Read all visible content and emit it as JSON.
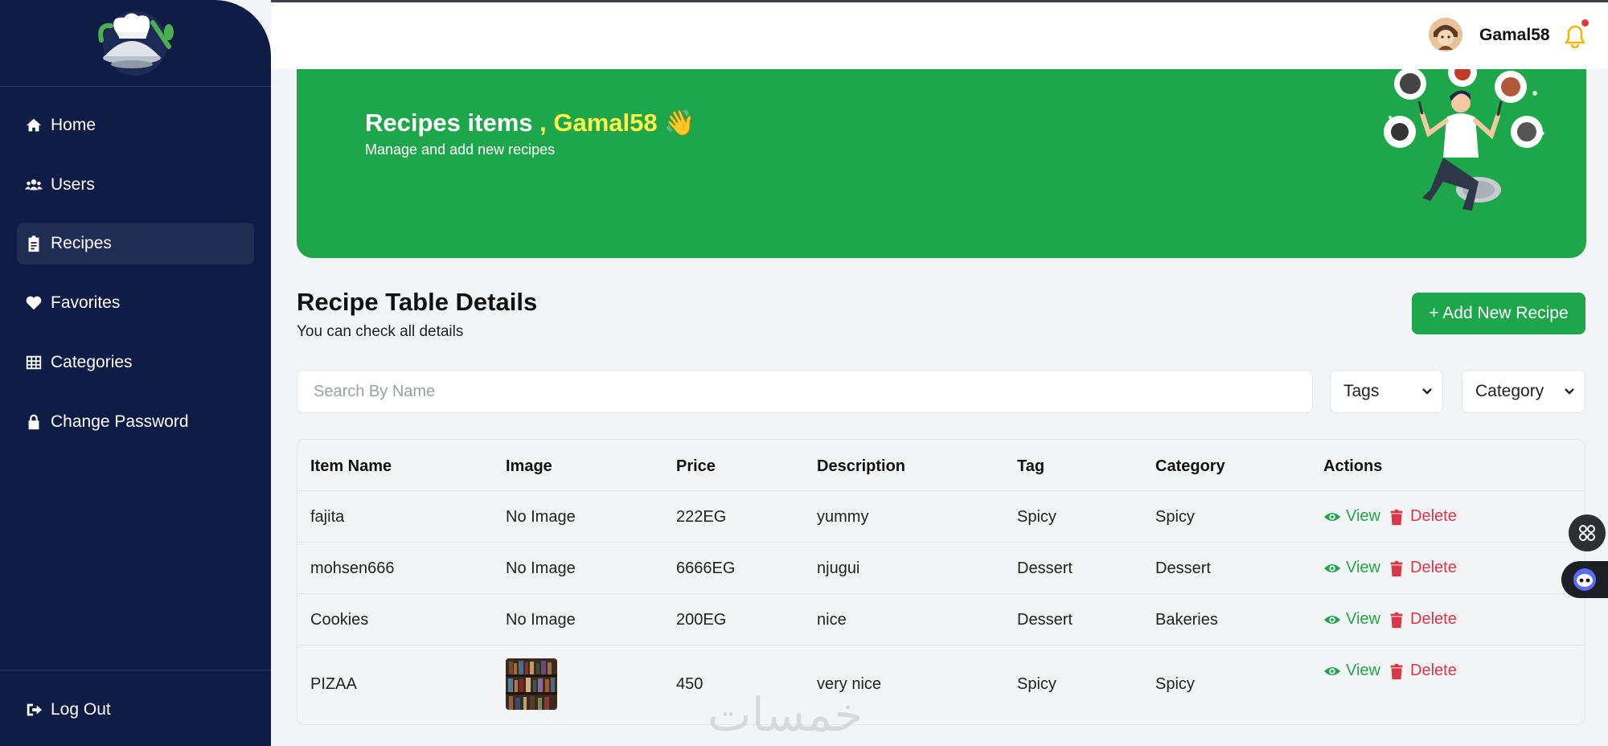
{
  "sidebar": {
    "items": [
      {
        "label": "Home",
        "icon": "home-icon"
      },
      {
        "label": "Users",
        "icon": "users-icon"
      },
      {
        "label": "Recipes",
        "icon": "clipboard-icon",
        "active": true
      },
      {
        "label": "Favorites",
        "icon": "heart-icon"
      },
      {
        "label": "Categories",
        "icon": "grid-icon"
      },
      {
        "label": "Change Password",
        "icon": "lock-icon"
      }
    ],
    "logout_label": "Log Out"
  },
  "header": {
    "username": "Gamal58",
    "has_notification": true
  },
  "banner": {
    "title_prefix": "Recipes items",
    "title_sep": " , ",
    "title_name": "Gamal58",
    "title_emoji": "👋",
    "subtitle": "Manage and add new recipes"
  },
  "section": {
    "title": "Recipe Table Details",
    "subtitle": "You can check all details",
    "add_button": "+ Add New Recipe"
  },
  "filters": {
    "search_placeholder": "Search By Name",
    "tags_label": "Tags",
    "category_label": "Category"
  },
  "table": {
    "headers": [
      "Item Name",
      "Image",
      "Price",
      "Description",
      "Tag",
      "Category",
      "Actions"
    ],
    "rows": [
      {
        "name": "fajita",
        "image": "No Image",
        "price": "222EG",
        "description": "yummy",
        "tag": "Spicy",
        "category": "Spicy"
      },
      {
        "name": "mohsen666",
        "image": "No Image",
        "price": "6666EG",
        "description": "njugui",
        "tag": "Dessert",
        "category": "Dessert"
      },
      {
        "name": "Cookies",
        "image": "No Image",
        "price": "200EG",
        "description": "nice",
        "tag": "Dessert",
        "category": "Bakeries"
      },
      {
        "name": "PIZAA",
        "image": "",
        "price": "450",
        "description": "very nice",
        "tag": "Spicy",
        "category": "Spicy"
      }
    ],
    "view_label": "View",
    "delete_label": "Delete"
  },
  "watermark": "خمسات",
  "colors": {
    "sidebar_bg": "#0f1c45",
    "accent_green": "#1ea64b",
    "danger_red": "#dc3545",
    "highlight_yellow": "#fff34d"
  }
}
